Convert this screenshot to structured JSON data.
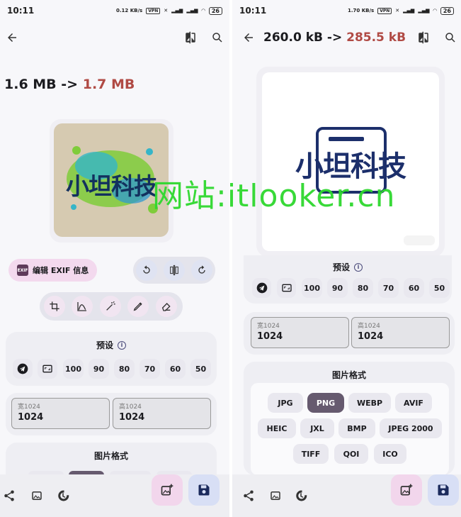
{
  "left": {
    "status": {
      "time": "10:11",
      "speed": "0.12 KB/s",
      "battery": "26"
    },
    "header": {
      "size_from": "1.6 MB",
      "arrow": " -> ",
      "size_to": "1.7 MB"
    },
    "logo_text": "小坦科技",
    "exif_label": "编辑 EXIF 信息",
    "presets": {
      "title": "预设",
      "values": [
        "100",
        "90",
        "80",
        "70",
        "60",
        "50"
      ]
    },
    "width": {
      "label": "宽1024",
      "value": "1024"
    },
    "height": {
      "label": "高1024",
      "value": "1024"
    },
    "format_title": "图片格式"
  },
  "right": {
    "status": {
      "time": "10:11",
      "speed": "1.70 KB/s",
      "battery": "26"
    },
    "header": {
      "size_from": "260.0 kB",
      "arrow": " -> ",
      "size_to": "285.5 kB"
    },
    "logo_text": "小坦科技",
    "presets": {
      "title": "预设",
      "values": [
        "100",
        "90",
        "80",
        "70",
        "60",
        "50"
      ]
    },
    "width": {
      "label": "宽1024",
      "value": "1024"
    },
    "height": {
      "label": "高1024",
      "value": "1024"
    },
    "format_title": "图片格式",
    "formats_row1": [
      "JPG",
      "PNG",
      "WEBP",
      "AVIF"
    ],
    "formats_row2": [
      "HEIC",
      "JXL",
      "BMP",
      "JPEG 2000"
    ],
    "formats_row3": [
      "TIFF",
      "QOI",
      "ICO"
    ],
    "selected_format": "PNG"
  },
  "watermark": "网站:itlooker.cn",
  "colors": {
    "accent_red": "#b04a44",
    "selected_chip": "#665a6f",
    "fab_pink": "#f2d6ec",
    "fab_blue": "#d8dff5",
    "watermark_green": "#2ed82e"
  }
}
